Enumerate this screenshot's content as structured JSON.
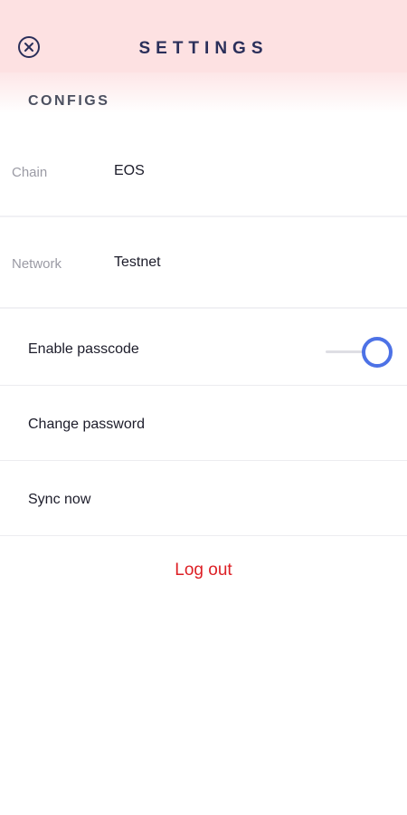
{
  "header": {
    "title": "SETTINGS",
    "close_icon": "close-circle-icon",
    "background_color": "#fde1e2"
  },
  "configs": {
    "section_title": "CONFIGS",
    "chain": {
      "label": "Chain",
      "value": "EOS"
    },
    "network": {
      "label": "Network",
      "value": "Testnet"
    }
  },
  "settings": {
    "enable_passcode": {
      "label": "Enable passcode",
      "enabled": true
    },
    "change_password": {
      "label": "Change password"
    },
    "sync_now": {
      "label": "Sync now"
    }
  },
  "logout": {
    "label": "Log out",
    "color": "#dd1f25"
  },
  "accent_color": "#4d72e6"
}
